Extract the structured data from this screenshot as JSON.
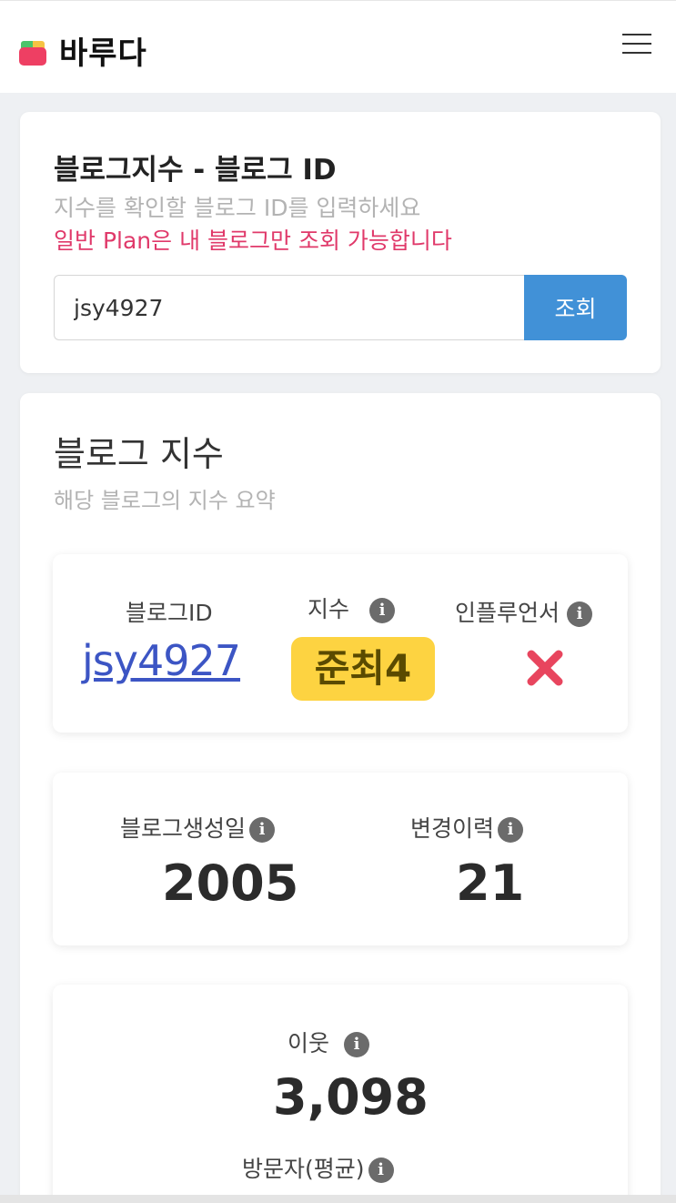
{
  "header": {
    "logo_text": "바루다",
    "menu_icon": "hamburger-icon"
  },
  "search_card": {
    "title": "블로그지수 - 블로그 ID",
    "subtitle": "지수를 확인할 블로그 ID를 입력하세요",
    "warning": "일반 Plan은 내 블로그만 조회 가능합니다",
    "input_value": "jsy4927",
    "button_label": "조회"
  },
  "index_card": {
    "title": "블로그 지수",
    "subtitle": "해당 블로그의 지수 요약",
    "summary": {
      "blog_id_label": "블로그ID",
      "blog_id_value": "jsy4927",
      "grade_label": "지수",
      "grade_value": "준최4",
      "influencer_label": "인플루언서",
      "influencer_value": "x-mark-icon"
    },
    "history": {
      "created_label": "블로그생성일",
      "created_value": "2005",
      "changes_label": "변경이력",
      "changes_value": "21"
    },
    "traffic": {
      "neighbors_label": "이웃",
      "neighbors_value": "3,098",
      "visitors_label": "방문자(평균)"
    }
  },
  "colors": {
    "accent_blue": "#4191d7",
    "warning_pink": "#e0396a",
    "link_blue": "#3c55c4",
    "badge_yellow": "#fdd341",
    "x_red": "#e8455e"
  }
}
